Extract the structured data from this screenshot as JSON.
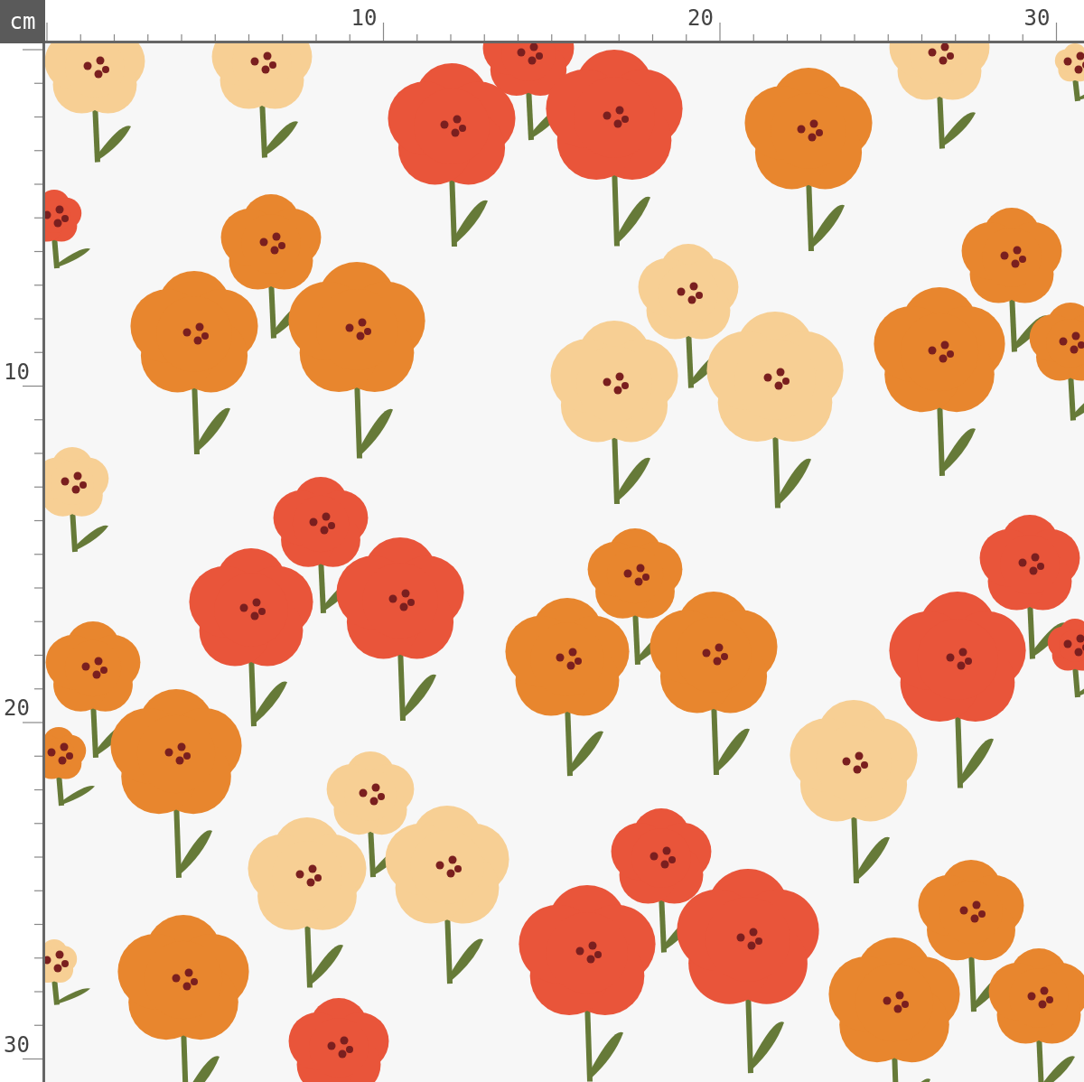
{
  "ruler": {
    "unit": "cm",
    "top_labels": [
      "10",
      "20",
      "30"
    ],
    "left_labels": [
      "10",
      "20",
      "30"
    ]
  }
}
